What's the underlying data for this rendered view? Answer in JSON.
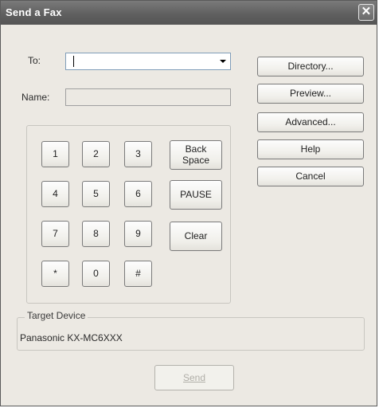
{
  "window": {
    "title": "Send a Fax",
    "close_glyph": "✕"
  },
  "form": {
    "to_label": "To:",
    "to_value": "",
    "name_label": "Name:",
    "name_value": ""
  },
  "side_buttons": {
    "directory": "Directory...",
    "preview": "Preview...",
    "advanced": "Advanced...",
    "help": "Help",
    "cancel": "Cancel"
  },
  "keypad": {
    "keys": [
      "1",
      "2",
      "3",
      "4",
      "5",
      "6",
      "7",
      "8",
      "9",
      "*",
      "0",
      "#"
    ],
    "back_space_line1": "Back",
    "back_space_line2": "Space",
    "pause": "PAUSE",
    "clear": "Clear"
  },
  "target_device": {
    "legend": "Target Device",
    "value": "Panasonic KX-MC6XXX"
  },
  "send_button": {
    "label": "Send",
    "enabled": false
  },
  "icons": {
    "close": "close-icon",
    "dropdown": "chevron-down-icon"
  }
}
